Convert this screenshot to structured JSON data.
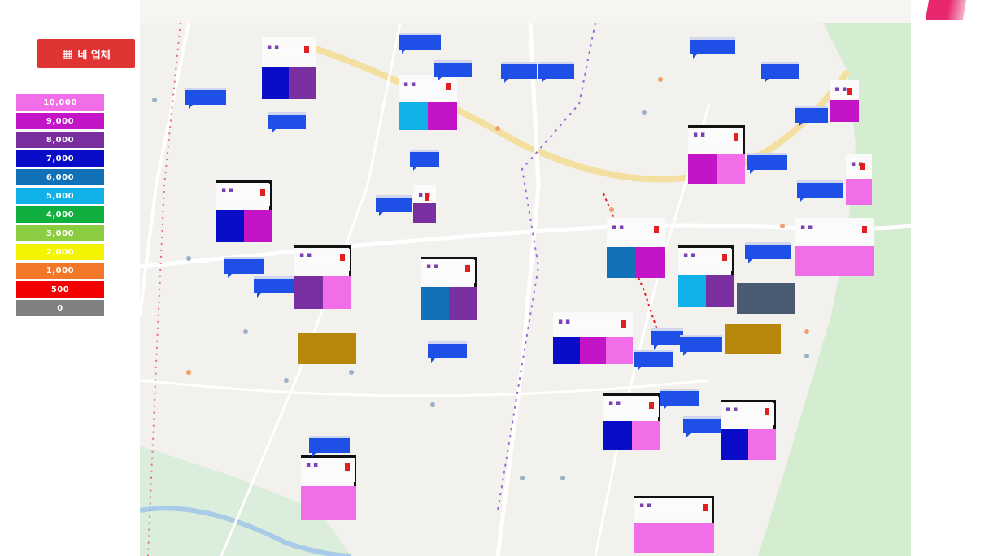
{
  "mode_button": {
    "icon": "grid-icon",
    "label": "네 업체"
  },
  "legend": [
    {
      "label": "10,000",
      "color": "#f26ee8"
    },
    {
      "label": "9,000",
      "color": "#c414c8"
    },
    {
      "label": "8,000",
      "color": "#7a2fa0"
    },
    {
      "label": "7,000",
      "color": "#0a0dc8"
    },
    {
      "label": "6,000",
      "color": "#1070b8"
    },
    {
      "label": "5,000",
      "color": "#10b0e8"
    },
    {
      "label": "4,000",
      "color": "#10b040"
    },
    {
      "label": "3,000",
      "color": "#8ccc40"
    },
    {
      "label": "2,000",
      "color": "#f4f400"
    },
    {
      "label": "1,000",
      "color": "#f07828"
    },
    {
      "label": "500",
      "color": "#f40000"
    },
    {
      "label": "0",
      "color": "#808080"
    }
  ],
  "markers": [
    {
      "colors": [
        "#0a0dc8",
        "#7a2fa0"
      ],
      "caption": "",
      "bracket": false
    },
    {
      "colors": [
        "#10b0e8",
        "#c414c8"
      ],
      "caption": "",
      "bracket": false
    },
    {
      "colors": [
        "#7a2fa0"
      ],
      "caption": "",
      "bracket": false
    },
    {
      "colors": [
        "#0a0dc8",
        "#c414c8"
      ],
      "caption": "",
      "bracket": true
    },
    {
      "colors": [
        "#7a2fa0",
        "#f26ee8"
      ],
      "caption": "",
      "bracket": true
    },
    {
      "colors": [
        "#1070b8",
        "#7a2fa0"
      ],
      "caption": "",
      "bracket": true
    },
    {
      "colors": [
        "#c414c8",
        "#f26ee8"
      ],
      "caption": "",
      "bracket": true
    },
    {
      "colors": [
        "#c414c8"
      ],
      "caption": "",
      "bracket": false
    },
    {
      "colors": [
        "#f26ee8"
      ],
      "caption": "",
      "bracket": false
    },
    {
      "colors": [
        "#1070b8",
        "#c414c8"
      ],
      "caption": "",
      "bracket": false
    },
    {
      "colors": [
        "#10b0e8",
        "#7a2fa0"
      ],
      "caption": "",
      "bracket": true
    },
    {
      "colors": [
        "#f26ee8"
      ],
      "caption": "",
      "bracket": false
    },
    {
      "colors": [
        "#0a0dc8",
        "#c414c8",
        "#f26ee8"
      ],
      "caption": "",
      "bracket": false
    },
    {
      "colors": [
        "#0a0dc8",
        "#f26ee8"
      ],
      "caption": "",
      "bracket": true
    },
    {
      "colors": [
        "#0a0dc8",
        "#f26ee8"
      ],
      "caption": "",
      "bracket": true
    },
    {
      "colors": [
        "#f26ee8"
      ],
      "caption": "",
      "bracket": true
    },
    {
      "colors": [
        "#f26ee8"
      ],
      "caption": "",
      "bracket": true
    }
  ],
  "tags": [
    "",
    "",
    "",
    "",
    "",
    "",
    "",
    "",
    "",
    "",
    "",
    "",
    "",
    "",
    "",
    "",
    "",
    "",
    "",
    "",
    "",
    "",
    ""
  ],
  "info_boxes": [
    {
      "color": "#b8860b",
      "line1": "",
      "line2": ""
    },
    {
      "color": "#4a5a70",
      "line1": "",
      "line2": ""
    },
    {
      "color": "#b8860b",
      "line1": "",
      "line2": ""
    }
  ]
}
